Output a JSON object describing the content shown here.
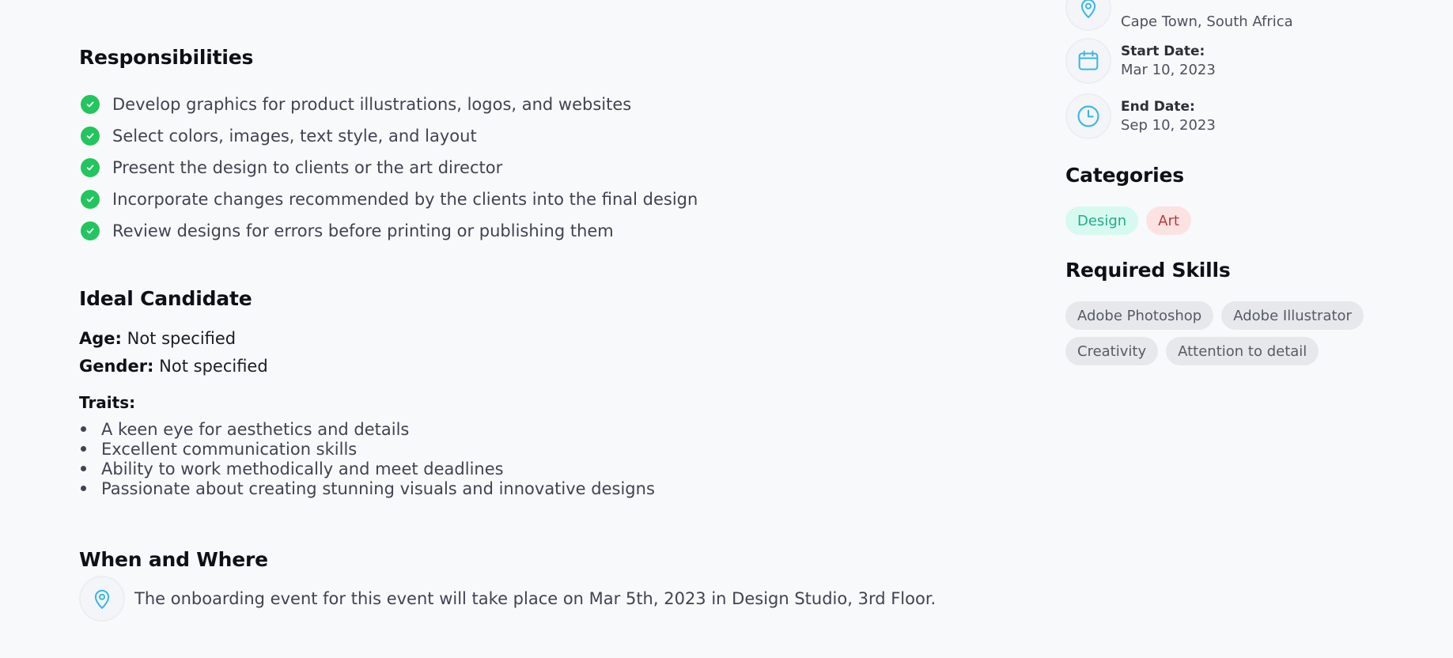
{
  "responsibilities": {
    "title": "Responsibilities",
    "items": [
      "Develop graphics for product illustrations, logos, and websites",
      "Select colors, images, text style, and layout",
      "Present the design to clients or the art director",
      "Incorporate changes recommended by the clients into the final design",
      "Review designs for errors before printing or publishing them"
    ]
  },
  "ideal_candidate": {
    "title": "Ideal Candidate",
    "age_label": "Age:",
    "age_value": "Not specified",
    "gender_label": "Gender:",
    "gender_value": "Not specified",
    "traits_label": "Traits:",
    "traits": [
      "A keen eye for aesthetics and details",
      "Excellent communication skills",
      "Ability to work methodically and meet deadlines",
      "Passionate about creating stunning visuals and innovative designs"
    ]
  },
  "when_where": {
    "title": "When and Where",
    "text": "The onboarding event for this event will take place on Mar 5th, 2023 in Design Studio, 3rd Floor."
  },
  "sidebar": {
    "location_value": "Cape Town, South Africa",
    "start_label": "Start Date:",
    "start_value": "Mar 10, 2023",
    "end_label": "End Date:",
    "end_value": "Sep 10, 2023",
    "categories_title": "Categories",
    "categories": [
      "Design",
      "Art"
    ],
    "skills_title": "Required Skills",
    "skills": [
      "Adobe Photoshop",
      "Adobe Illustrator",
      "Creativity",
      "Attention to detail"
    ]
  },
  "colors": {
    "accent_blue": "#38b6e8",
    "check_green": "#22c55e",
    "design_tag_bg": "#d7faf0",
    "art_tag_bg": "#fde2e2",
    "skill_tag_bg": "#e7e8eb"
  }
}
